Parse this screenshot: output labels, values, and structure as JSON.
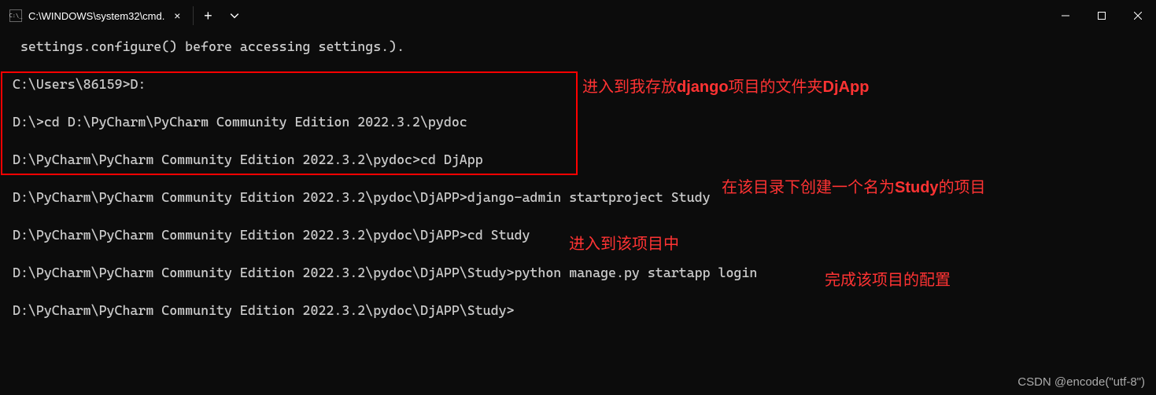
{
  "titlebar": {
    "tab_title": "C:\\WINDOWS\\system32\\cmd.",
    "close_glyph": "×",
    "plus_glyph": "+",
    "chevron_glyph": "⌄"
  },
  "terminal": {
    "line1": " settings.configure() before accessing settings.).",
    "line2": "",
    "line3": "C:\\Users\\86159>D:",
    "line4": "",
    "line5": "D:\\>cd D:\\PyCharm\\PyCharm Community Edition 2022.3.2\\pydoc",
    "line6": "",
    "line7": "D:\\PyCharm\\PyCharm Community Edition 2022.3.2\\pydoc>cd DjApp",
    "line8": "",
    "line9": "D:\\PyCharm\\PyCharm Community Edition 2022.3.2\\pydoc\\DjAPP>django-admin startproject Study",
    "line10": "",
    "line11": "D:\\PyCharm\\PyCharm Community Edition 2022.3.2\\pydoc\\DjAPP>cd Study",
    "line12": "",
    "line13": "D:\\PyCharm\\PyCharm Community Edition 2022.3.2\\pydoc\\DjAPP\\Study>python manage.py startapp login",
    "line14": "",
    "line15": "D:\\PyCharm\\PyCharm Community Edition 2022.3.2\\pydoc\\DjAPP\\Study>"
  },
  "annotations": {
    "ann1_pre": "进入到我存放",
    "ann1_bold1": "django",
    "ann1_mid": "项目的文件夹",
    "ann1_bold2": "DjApp",
    "ann2_pre": "在该目录下创建一个名为",
    "ann2_bold": "Study",
    "ann2_post": "的项目",
    "ann3": "进入到该项目中",
    "ann4": "完成该项目的配置"
  },
  "watermark": "CSDN @encode(\"utf-8\")"
}
